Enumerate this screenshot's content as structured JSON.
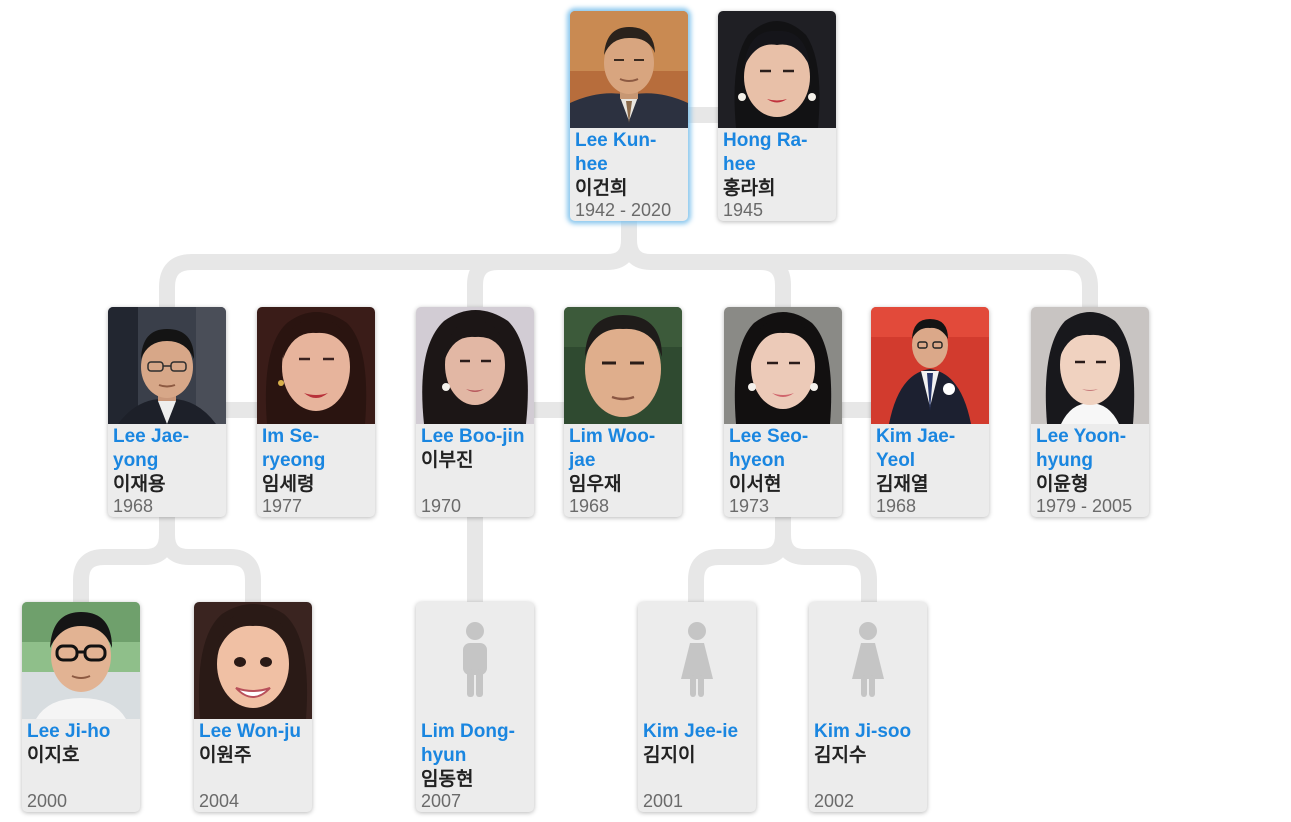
{
  "people": [
    {
      "id": "kunhee",
      "name": "Lee Kun-hee",
      "native": "이건희",
      "years": "1942 - 2020",
      "photo": "man-portrait",
      "selected": true
    },
    {
      "id": "rahee",
      "name": "Hong Ra-hee",
      "native": "홍라희",
      "years": "1945",
      "photo": "woman-portrait"
    },
    {
      "id": "jaeyong",
      "name": "Lee Jae-yong",
      "native": "이재용",
      "years": "1968",
      "photo": "man-portrait"
    },
    {
      "id": "seryeong",
      "name": "Im Se-ryeong",
      "native": "임세령",
      "years": "1977",
      "photo": "woman-portrait"
    },
    {
      "id": "boojin",
      "name": "Lee Boo-jin",
      "native": "이부진",
      "years": "1970",
      "photo": "woman-portrait"
    },
    {
      "id": "woojae",
      "name": "Lim Woo-jae",
      "native": "임우재",
      "years": "1968",
      "photo": "man-portrait"
    },
    {
      "id": "seohyeon",
      "name": "Lee Seo-hyeon",
      "native": "이서현",
      "years": "1973",
      "photo": "woman-portrait"
    },
    {
      "id": "jaeyeol",
      "name": "Kim Jae-Yeol",
      "native": "김재열",
      "years": "1968",
      "photo": "man-portrait"
    },
    {
      "id": "yoonhyung",
      "name": "Lee Yoon-hyung",
      "native": "이윤형",
      "years": "1979 - 2005",
      "photo": "woman-portrait"
    },
    {
      "id": "jiho",
      "name": "Lee Ji-ho",
      "native": "이지호",
      "years": "2000",
      "photo": "man-portrait"
    },
    {
      "id": "wonju",
      "name": "Lee Won-ju",
      "native": "이원주",
      "years": "2004",
      "photo": "woman-portrait"
    },
    {
      "id": "donghyun",
      "name": "Lim Dong-hyun",
      "native": "임동현",
      "years": "2007",
      "photo": "male-silhouette-icon"
    },
    {
      "id": "jeeie",
      "name": "Kim Jee-ie",
      "native": "김지이",
      "years": "2001",
      "photo": "female-silhouette-icon"
    },
    {
      "id": "jisoo",
      "name": "Kim Ji-soo",
      "native": "김지수",
      "years": "2002",
      "photo": "female-silhouette-icon"
    }
  ],
  "colors": {
    "name": "#1a86e0",
    "native": "#222222",
    "years": "#6a6a6a",
    "card": "#ececec",
    "connector": "#e7e7e7",
    "selected_glow": "#78bee8"
  }
}
